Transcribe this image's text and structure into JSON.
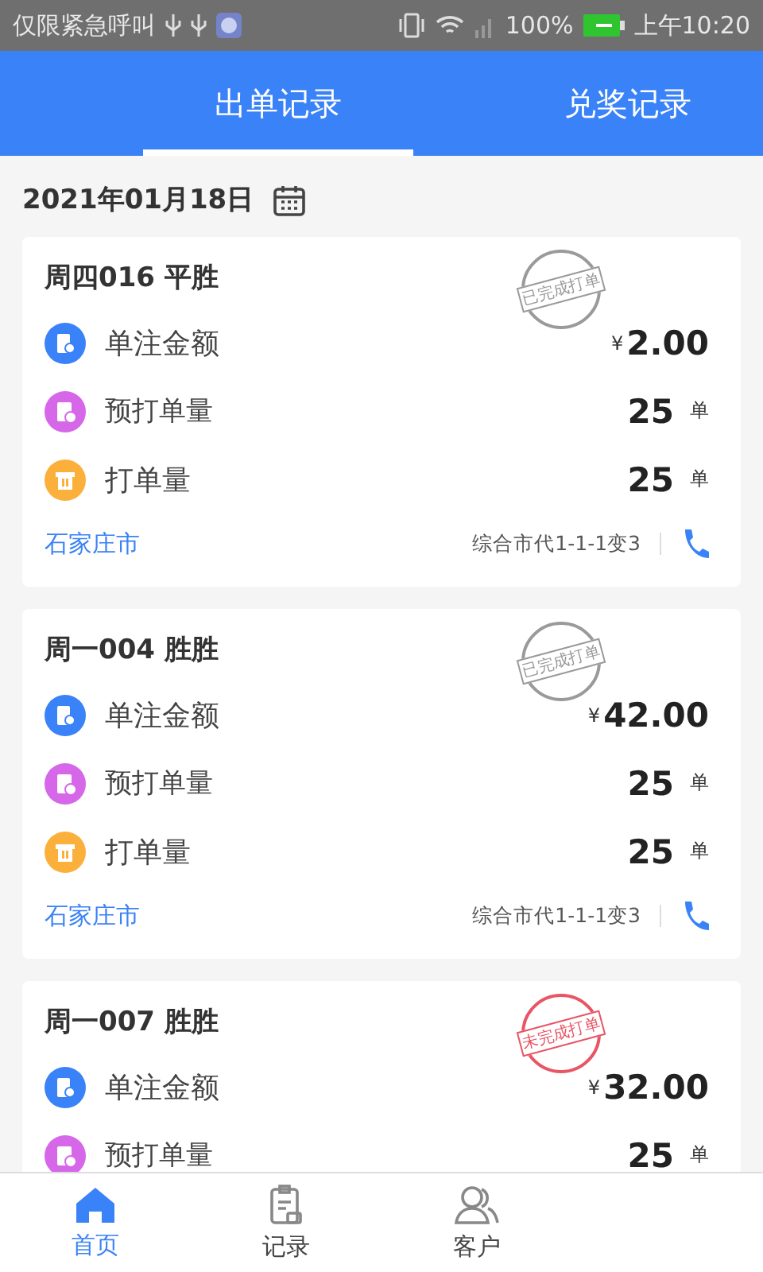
{
  "status_bar": {
    "carrier": "仅限紧急呼叫",
    "battery": "100%",
    "time": "上午10:20"
  },
  "tabs": [
    {
      "label": "出单记录",
      "selected": true
    },
    {
      "label": "兑奖记录",
      "selected": false
    }
  ],
  "date": "2021年01月18日",
  "orders": [
    {
      "title": "周四016 平胜",
      "stamp": {
        "text": "已完成打单",
        "kind": "done"
      },
      "rows": [
        {
          "kind": "amount",
          "label": "单注金额",
          "currency": "¥",
          "value": "2.00"
        },
        {
          "kind": "planned",
          "label": "预打单量",
          "value": "25",
          "unit": "单"
        },
        {
          "kind": "printed",
          "label": "打单量",
          "value": "25",
          "unit": "单"
        }
      ],
      "city": "石家庄市",
      "shop": "综合市代1-1-1变3"
    },
    {
      "title": "周一004 胜胜",
      "stamp": {
        "text": "已完成打单",
        "kind": "done"
      },
      "rows": [
        {
          "kind": "amount",
          "label": "单注金额",
          "currency": "¥",
          "value": "42.00"
        },
        {
          "kind": "planned",
          "label": "预打单量",
          "value": "25",
          "unit": "单"
        },
        {
          "kind": "printed",
          "label": "打单量",
          "value": "25",
          "unit": "单"
        }
      ],
      "city": "石家庄市",
      "shop": "综合市代1-1-1变3"
    },
    {
      "title": "周一007 胜胜",
      "stamp": {
        "text": "未完成打单",
        "kind": "pending"
      },
      "rows": [
        {
          "kind": "amount",
          "label": "单注金额",
          "currency": "¥",
          "value": "32.00"
        },
        {
          "kind": "planned",
          "label": "预打单量",
          "value": "25",
          "unit": "单"
        }
      ]
    }
  ],
  "nav": [
    {
      "label": "首页",
      "kind": "home",
      "selected": true
    },
    {
      "label": "记录",
      "kind": "records",
      "selected": false
    },
    {
      "label": "客户",
      "kind": "customers",
      "selected": false
    }
  ]
}
